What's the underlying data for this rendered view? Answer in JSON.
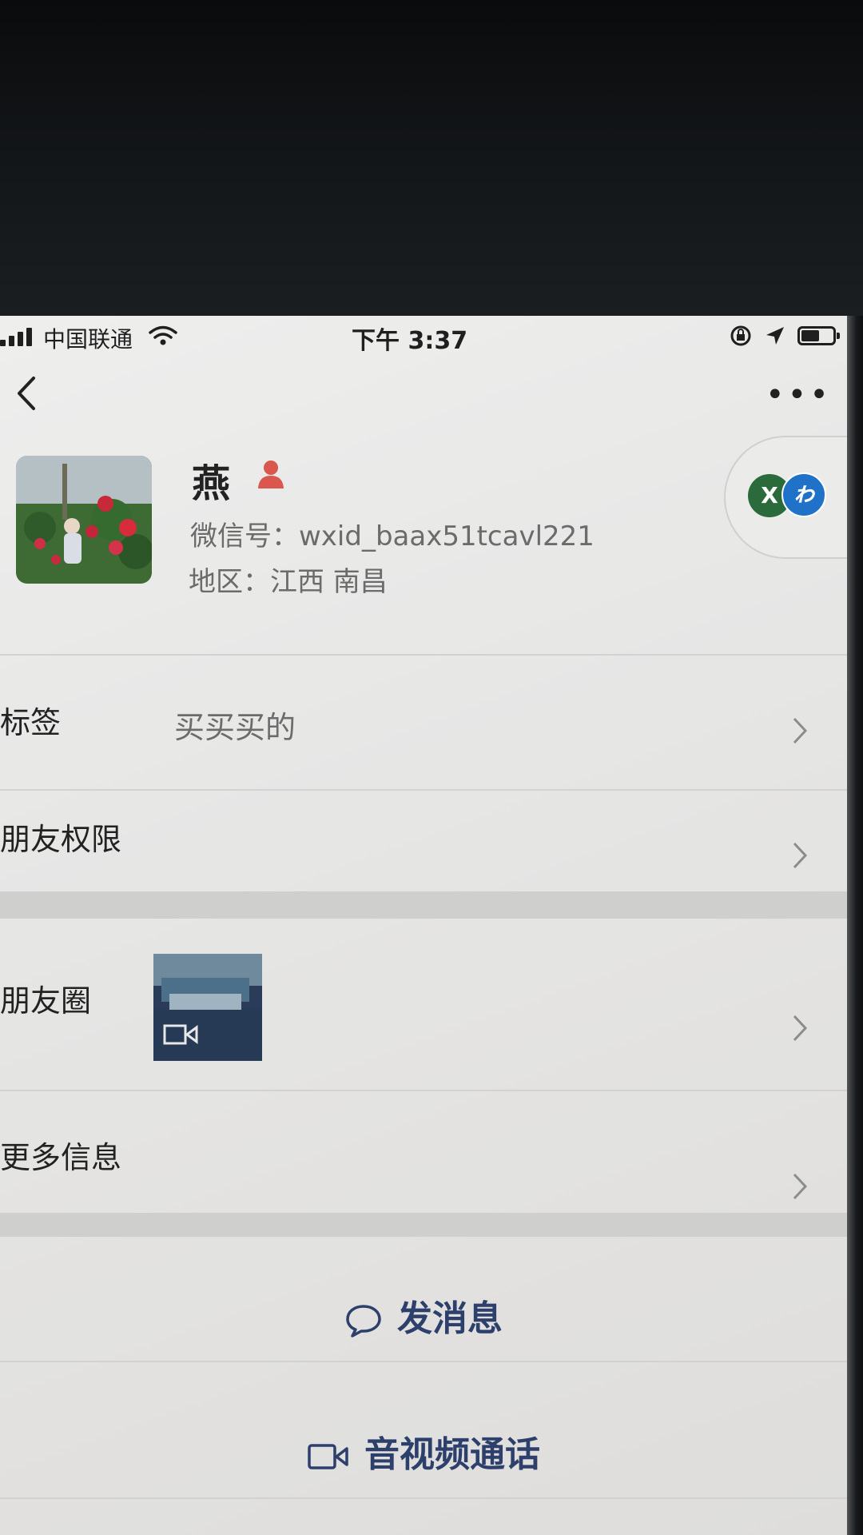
{
  "status_bar": {
    "carrier": "中国联通",
    "time": "下午 3:37"
  },
  "profile": {
    "name": "燕",
    "wechat_id": "微信号：wxid_baax51tcavl221",
    "region": "地区：江西 南昌"
  },
  "rows": {
    "tags_label": "标签",
    "tags_value": "买买买的",
    "friend_permissions_label": "朋友权限",
    "moments_label": "朋友圈",
    "more_info_label": "更多信息"
  },
  "actions": {
    "send_message": "发消息",
    "video_call": "音视频通话"
  },
  "colors": {
    "action_text": "#2d3f6b",
    "gender_female": "#d9574c",
    "badge_green": "#2b6b3b",
    "badge_blue": "#1f72c8"
  }
}
